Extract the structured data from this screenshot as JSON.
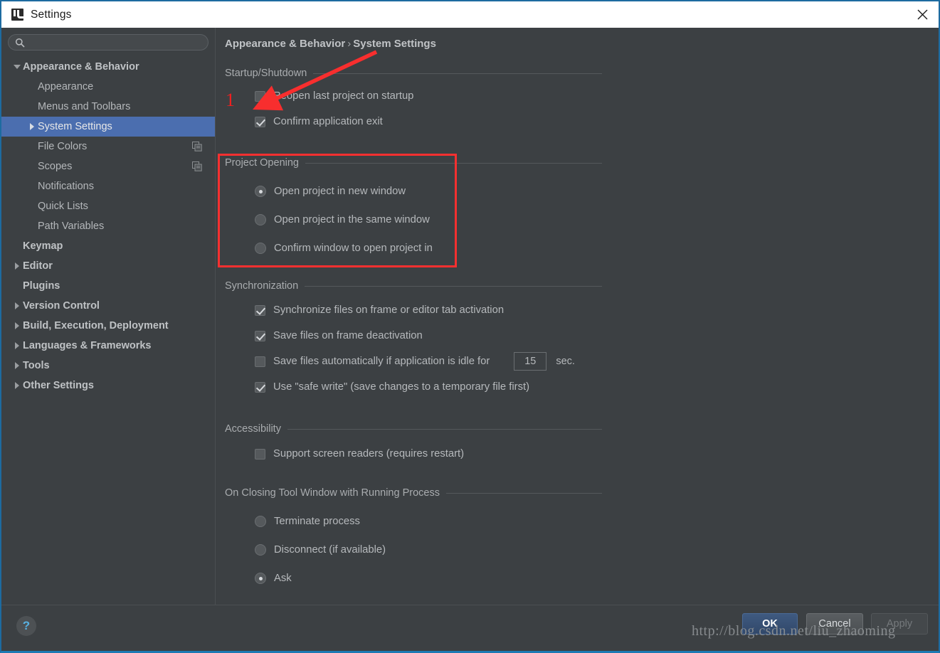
{
  "window": {
    "title": "Settings",
    "icon": "intellij-idea-icon",
    "close_icon": "close-icon"
  },
  "sidebar": {
    "search": {
      "value": "",
      "placeholder": "",
      "icon": "search-icon"
    },
    "items": [
      {
        "label": "Appearance & Behavior",
        "level": 0,
        "expander": "down",
        "bold": true,
        "selected": false,
        "badge": ""
      },
      {
        "label": "Appearance",
        "level": 1,
        "expander": "none",
        "bold": false,
        "selected": false,
        "badge": ""
      },
      {
        "label": "Menus and Toolbars",
        "level": 1,
        "expander": "none",
        "bold": false,
        "selected": false,
        "badge": ""
      },
      {
        "label": "System Settings",
        "level": 1,
        "expander": "right",
        "bold": false,
        "selected": true,
        "badge": ""
      },
      {
        "label": "File Colors",
        "level": 1,
        "expander": "none",
        "bold": false,
        "selected": false,
        "badge": "copy-icon"
      },
      {
        "label": "Scopes",
        "level": 1,
        "expander": "none",
        "bold": false,
        "selected": false,
        "badge": "copy-icon"
      },
      {
        "label": "Notifications",
        "level": 1,
        "expander": "none",
        "bold": false,
        "selected": false,
        "badge": ""
      },
      {
        "label": "Quick Lists",
        "level": 1,
        "expander": "none",
        "bold": false,
        "selected": false,
        "badge": ""
      },
      {
        "label": "Path Variables",
        "level": 1,
        "expander": "none",
        "bold": false,
        "selected": false,
        "badge": ""
      },
      {
        "label": "Keymap",
        "level": 0,
        "expander": "none",
        "bold": true,
        "selected": false,
        "badge": ""
      },
      {
        "label": "Editor",
        "level": 0,
        "expander": "right",
        "bold": true,
        "selected": false,
        "badge": ""
      },
      {
        "label": "Plugins",
        "level": 0,
        "expander": "none",
        "bold": true,
        "selected": false,
        "badge": ""
      },
      {
        "label": "Version Control",
        "level": 0,
        "expander": "right",
        "bold": true,
        "selected": false,
        "badge": ""
      },
      {
        "label": "Build, Execution, Deployment",
        "level": 0,
        "expander": "right",
        "bold": true,
        "selected": false,
        "badge": ""
      },
      {
        "label": "Languages & Frameworks",
        "level": 0,
        "expander": "right",
        "bold": true,
        "selected": false,
        "badge": ""
      },
      {
        "label": "Tools",
        "level": 0,
        "expander": "right",
        "bold": true,
        "selected": false,
        "badge": ""
      },
      {
        "label": "Other Settings",
        "level": 0,
        "expander": "right",
        "bold": true,
        "selected": false,
        "badge": ""
      }
    ]
  },
  "main": {
    "breadcrumb": {
      "parent": "Appearance & Behavior",
      "separator": "›",
      "current": "System Settings"
    },
    "groups": {
      "startup": {
        "title": "Startup/Shutdown",
        "options": [
          {
            "label": "Reopen last project on startup",
            "type": "checkbox",
            "checked": false
          },
          {
            "label": "Confirm application exit",
            "type": "checkbox",
            "checked": true
          }
        ]
      },
      "project_opening": {
        "title": "Project Opening",
        "options": [
          {
            "label": "Open project in new window",
            "type": "radio",
            "checked": true
          },
          {
            "label": "Open project in the same window",
            "type": "radio",
            "checked": false
          },
          {
            "label": "Confirm window to open project in",
            "type": "radio",
            "checked": false
          }
        ]
      },
      "synchronization": {
        "title": "Synchronization",
        "options": [
          {
            "label": "Synchronize files on frame or editor tab activation",
            "type": "checkbox",
            "checked": true
          },
          {
            "label": "Save files on frame deactivation",
            "type": "checkbox",
            "checked": true
          },
          {
            "label": "Save files automatically if application is idle for",
            "type": "checkbox",
            "checked": false,
            "spinner_value": "15",
            "suffix": "sec."
          },
          {
            "label": "Use \"safe write\" (save changes to a temporary file first)",
            "type": "checkbox",
            "checked": true
          }
        ]
      },
      "accessibility": {
        "title": "Accessibility",
        "options": [
          {
            "label": "Support screen readers (requires restart)",
            "type": "checkbox",
            "checked": false
          }
        ]
      },
      "on_closing": {
        "title": "On Closing Tool Window with Running Process",
        "options": [
          {
            "label": "Terminate process",
            "type": "radio",
            "checked": false
          },
          {
            "label": "Disconnect (if available)",
            "type": "radio",
            "checked": false
          },
          {
            "label": "Ask",
            "type": "radio",
            "checked": true
          }
        ]
      }
    }
  },
  "footer": {
    "help_label": "?",
    "ok_label": "OK",
    "cancel_label": "Cancel",
    "apply_label": "Apply"
  },
  "annotations": {
    "step_number": "1",
    "arrow_color": "#f82e2e",
    "box_color": "#f83030",
    "number_color": "#f02020"
  },
  "watermark": {
    "text": "http://blog.csdn.net/liu_zhaoming"
  },
  "colors": {
    "accent": "#4b6eaf",
    "background": "#3c4043",
    "titlebar": "#ffffff",
    "border": "#1d6ba0"
  }
}
